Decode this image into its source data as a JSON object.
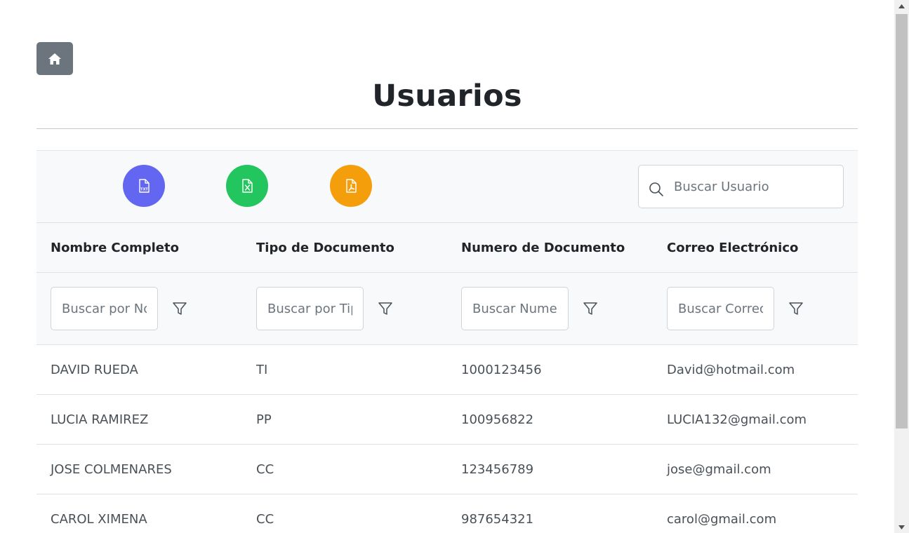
{
  "header": {
    "title": "Usuarios"
  },
  "toolbar": {
    "export_buttons": [
      {
        "name": "txt",
        "label": "TXT",
        "color": "#6366f1"
      },
      {
        "name": "excel",
        "label": "",
        "color": "#22c55e"
      },
      {
        "name": "pdf",
        "label": "",
        "color": "#f59e0b"
      }
    ],
    "search": {
      "placeholder": "Buscar Usuario",
      "value": ""
    }
  },
  "table": {
    "columns": [
      {
        "label": "Nombre Completo",
        "filter_placeholder": "Buscar por Nombre"
      },
      {
        "label": "Tipo de Documento",
        "filter_placeholder": "Buscar por Tipo"
      },
      {
        "label": "Numero de Documento",
        "filter_placeholder": "Buscar Numero"
      },
      {
        "label": "Correo Electrónico",
        "filter_placeholder": "Buscar Correo"
      }
    ],
    "rows": [
      [
        "DAVID RUEDA",
        "TI",
        "1000123456",
        "David@hotmail.com"
      ],
      [
        "LUCIA RAMIREZ",
        "PP",
        "100956822",
        "LUCIA132@gmail.com"
      ],
      [
        "JOSE COLMENARES",
        "CC",
        "123456789",
        "jose@gmail.com"
      ],
      [
        "CAROL XIMENA",
        "CC",
        "987654321",
        "carol@gmail.com"
      ]
    ]
  },
  "colors": {
    "home_button": "#6c757d",
    "header_bg": "#f8f9fa",
    "border": "#dee2e6"
  }
}
